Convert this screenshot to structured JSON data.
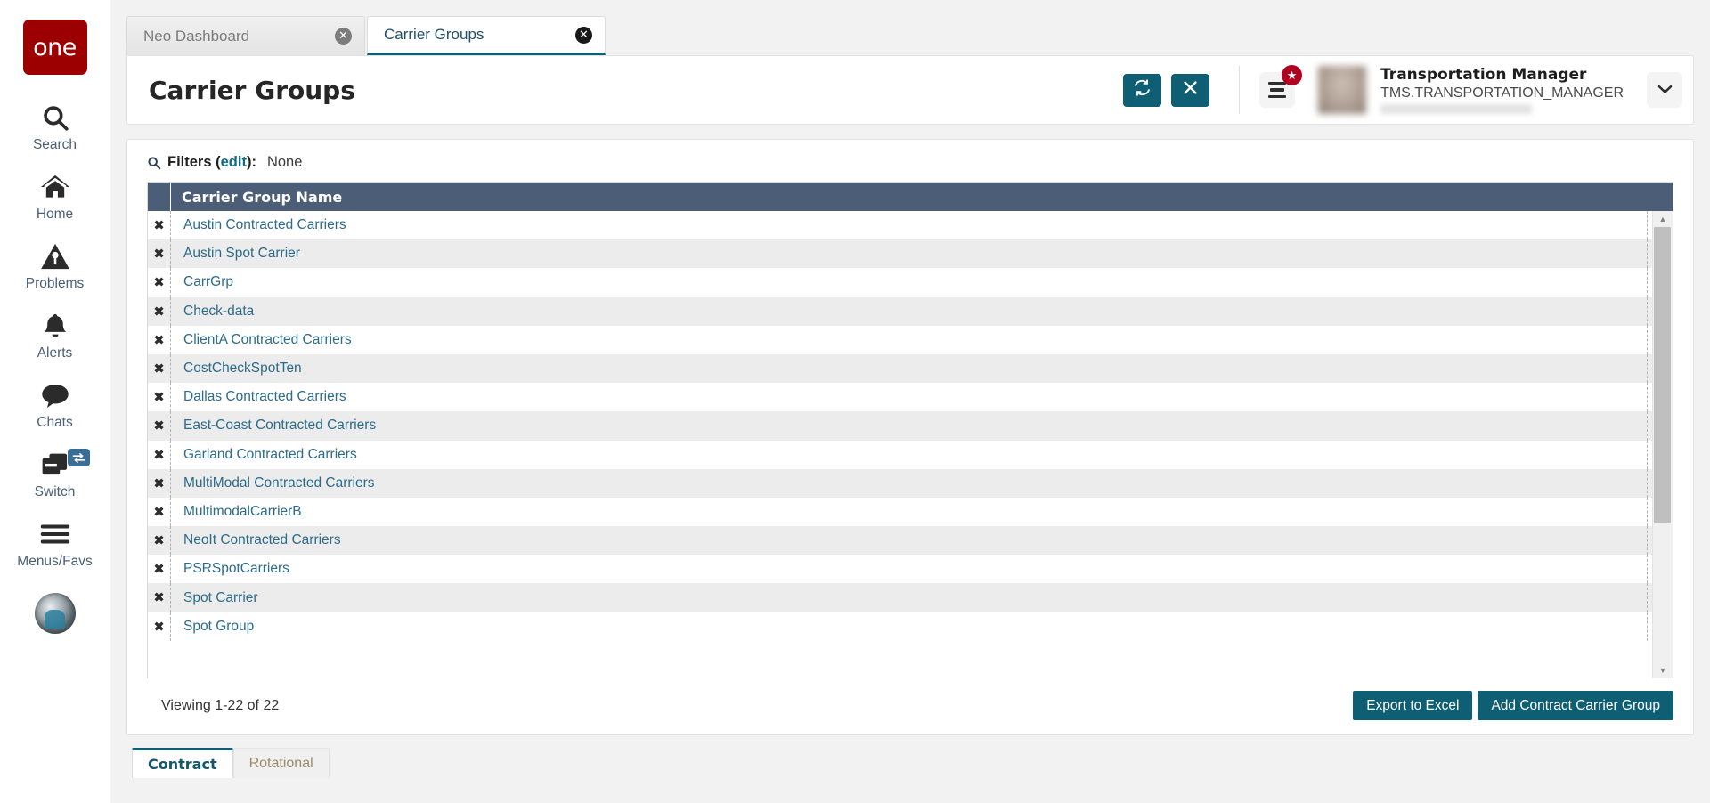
{
  "brand": {
    "logo_text": "one",
    "logo_color": "#9c0000"
  },
  "theme": {
    "accent": "#0e5e74",
    "table_header": "#4b5d77",
    "link": "#2c6b8a",
    "badge_red": "#b00020"
  },
  "rail": {
    "items": [
      {
        "label": "Search",
        "icon": "search-icon"
      },
      {
        "label": "Home",
        "icon": "home-icon"
      },
      {
        "label": "Problems",
        "icon": "warning-triangle-icon"
      },
      {
        "label": "Alerts",
        "icon": "bell-icon"
      },
      {
        "label": "Chats",
        "icon": "chat-bubble-icon"
      },
      {
        "label": "Switch",
        "icon": "windows-stack-icon",
        "badge_icon": "swap-arrows-icon"
      },
      {
        "label": "Menus/Favs",
        "icon": "hamburger-icon"
      }
    ],
    "profile_icon": "user-photo-avatar"
  },
  "tabs": [
    {
      "label": "Neo Dashboard",
      "active": false,
      "close_icon": "close-circle-icon"
    },
    {
      "label": "Carrier Groups",
      "active": true,
      "close_icon": "close-circle-icon"
    }
  ],
  "header": {
    "title": "Carrier Groups",
    "refresh_icon": "refresh-icon",
    "close_icon": "close-x-icon",
    "menu_icon": "hamburger-menu-icon",
    "menu_badge_icon": "star-icon",
    "chevron_icon": "chevron-down-icon",
    "user": {
      "name": "Transportation Manager",
      "username": "TMS.TRANSPORTATION_MANAGER"
    }
  },
  "filters": {
    "search_icon": "search-icon",
    "label": "Filters",
    "edit_link": "edit",
    "suffix": ":",
    "value": "None"
  },
  "table": {
    "columns": [
      "Carrier Group Name"
    ],
    "rows": [
      {
        "name": "Austin Contracted Carriers"
      },
      {
        "name": "Austin Spot Carrier"
      },
      {
        "name": "CarrGrp"
      },
      {
        "name": "Check-data"
      },
      {
        "name": "ClientA Contracted Carriers"
      },
      {
        "name": "CostCheckSpotTen"
      },
      {
        "name": "Dallas Contracted Carriers"
      },
      {
        "name": "East-Coast Contracted Carriers"
      },
      {
        "name": "Garland Contracted Carriers"
      },
      {
        "name": "MultiModal Contracted Carriers"
      },
      {
        "name": "MultimodalCarrierB"
      },
      {
        "name": "NeoIt Contracted Carriers"
      },
      {
        "name": "PSRSpotCarriers"
      },
      {
        "name": "Spot Carrier"
      },
      {
        "name": "Spot Group"
      }
    ],
    "delete_icon": "delete-x-icon",
    "scrollbar": {
      "up_icon": "caret-up-icon",
      "down_icon": "caret-down-icon"
    }
  },
  "footer": {
    "viewing": "Viewing 1-22 of 22",
    "export_label": "Export to Excel",
    "add_label": "Add Contract Carrier Group"
  },
  "bottom_tabs": [
    {
      "label": "Contract",
      "active": true
    },
    {
      "label": "Rotational",
      "active": false
    }
  ]
}
